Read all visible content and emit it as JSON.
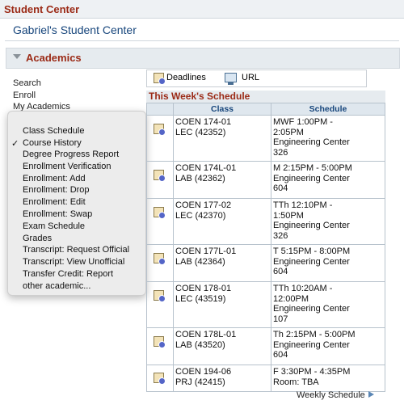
{
  "header": {
    "title": "Student Center"
  },
  "student_center_title": "Gabriel's Student Center",
  "academics": {
    "label": "Academics",
    "left_links": [
      "Search",
      "Enroll",
      "My Academics"
    ]
  },
  "dropdown": {
    "selected": "Course History",
    "items": [
      "Class Schedule",
      "Course History",
      "Degree Progress Report",
      "Enrollment Verification",
      "Enrollment: Add",
      "Enrollment: Drop",
      "Enrollment: Edit",
      "Enrollment: Swap",
      "Exam Schedule",
      "Grades",
      "Transcript: Request Official",
      "Transcript: View Unofficial",
      "Transfer Credit: Report",
      "other academic..."
    ]
  },
  "quick_links": {
    "deadlines": "Deadlines",
    "url": "URL"
  },
  "schedule": {
    "title": "This Week's Schedule",
    "col_class": "Class",
    "col_schedule": "Schedule",
    "rows": [
      {
        "class_line1": "COEN 174-01",
        "class_line2": "LEC (42352)",
        "sched": [
          "MWF 1:00PM -",
          "2:05PM",
          "Engineering Center",
          "326"
        ]
      },
      {
        "class_line1": "COEN 174L-01",
        "class_line2": "LAB (42362)",
        "sched": [
          "M 2:15PM - 5:00PM",
          "Engineering Center",
          "604"
        ]
      },
      {
        "class_line1": "COEN 177-02",
        "class_line2": "LEC (42370)",
        "sched": [
          "TTh 12:10PM -",
          "1:50PM",
          "Engineering Center",
          "326"
        ]
      },
      {
        "class_line1": "COEN 177L-01",
        "class_line2": "LAB (42364)",
        "sched": [
          "T 5:15PM - 8:00PM",
          "Engineering Center",
          "604"
        ]
      },
      {
        "class_line1": "COEN 178-01",
        "class_line2": "LEC (43519)",
        "sched": [
          "TTh 10:20AM -",
          "12:00PM",
          "Engineering Center",
          "107"
        ]
      },
      {
        "class_line1": "COEN 178L-01",
        "class_line2": "LAB (43520)",
        "sched": [
          "Th 2:15PM - 5:00PM",
          "Engineering Center",
          "604"
        ]
      },
      {
        "class_line1": "COEN 194-06",
        "class_line2": "PRJ (42415)",
        "sched": [
          "F 3:30PM - 4:35PM",
          "Room:  TBA"
        ]
      }
    ],
    "weekly_link": "Weekly Schedule"
  }
}
